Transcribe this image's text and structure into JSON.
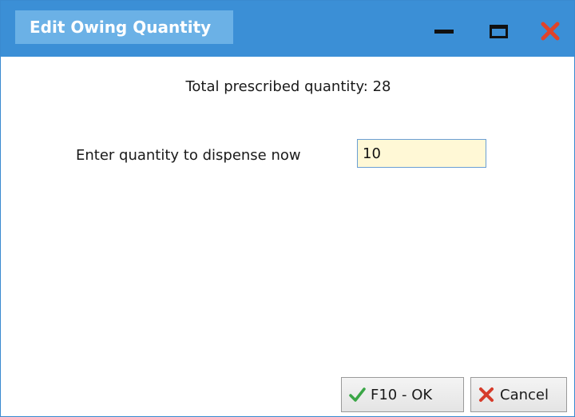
{
  "window": {
    "title": "Edit Owing Quantity",
    "controls": {
      "minimize_icon": "minimize-icon",
      "maximize_icon": "maximize-icon",
      "close_icon": "close-icon",
      "close_color": "#e0432a"
    },
    "title_bar_color": "#3b8fd6"
  },
  "main": {
    "total_prescribed_text": "Total prescribed quantity: 28",
    "dispense_label": "Enter quantity to dispense now",
    "dispense_value": "10"
  },
  "footer": {
    "ok_label": "F10 - OK",
    "ok_icon": "checkmark-icon",
    "ok_icon_color": "#3aa646",
    "cancel_label": "Cancel",
    "cancel_icon": "x-icon",
    "cancel_icon_color": "#d63b2a"
  }
}
